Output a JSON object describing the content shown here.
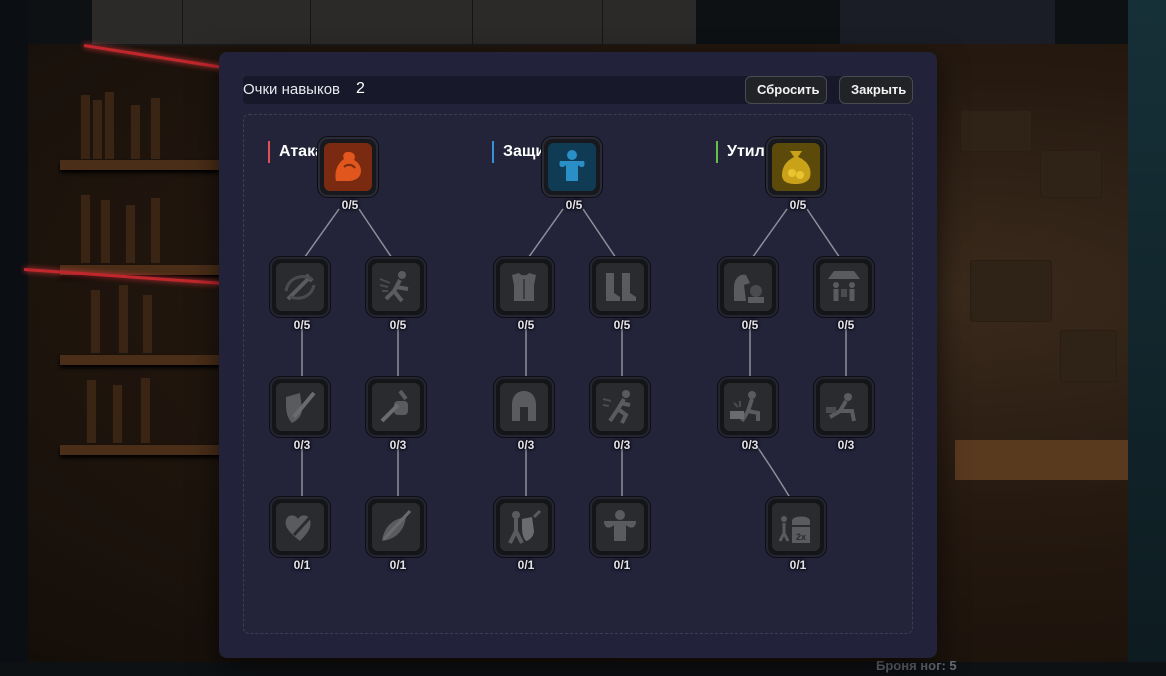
{
  "game": {
    "background_text": "Броня ног: 5"
  },
  "modal": {
    "header": {
      "points_label": "Очки навыков",
      "points_value": "2"
    },
    "buttons": {
      "reset": "Сбросить",
      "close": "Закрыть"
    },
    "branches": [
      {
        "title": "Атака",
        "accent": "#e05252",
        "root": {
          "icon": "flexed-biceps-icon",
          "level": "0/5",
          "color": "#d4541c"
        },
        "columns": [
          [
            {
              "icon": "sword-spin-icon",
              "level": "0/5"
            },
            {
              "icon": "sword-shield-icon",
              "level": "0/3"
            },
            {
              "icon": "heart-sword-icon",
              "level": "0/1"
            }
          ],
          [
            {
              "icon": "dodge-strike-icon",
              "level": "0/5"
            },
            {
              "icon": "fist-dagger-icon",
              "level": "0/3"
            },
            {
              "icon": "piercing-leaf-icon",
              "level": "0/1"
            }
          ]
        ]
      },
      {
        "title": "Защита",
        "accent": "#3b8fd9",
        "root": {
          "icon": "strong-man-icon",
          "level": "0/5",
          "color": "#2b8fc7"
        },
        "columns": [
          [
            {
              "icon": "chest-armor-icon",
              "level": "0/5"
            },
            {
              "icon": "helmet-icon",
              "level": "0/3"
            },
            {
              "icon": "deflect-warrior-icon",
              "level": "0/1"
            }
          ],
          [
            {
              "icon": "boots-icon",
              "level": "0/5"
            },
            {
              "icon": "running-dodge-icon",
              "level": "0/3"
            },
            {
              "icon": "muscle-body-icon",
              "level": "0/1"
            }
          ]
        ]
      },
      {
        "title": "Утилиты",
        "accent": "#62c24a",
        "root": {
          "icon": "gold-sack-icon",
          "level": "0/5",
          "color": "#c9a21a"
        },
        "columns": [
          [
            {
              "icon": "hand-coin-icon",
              "level": "0/5"
            },
            {
              "icon": "crafting-anvil-icon",
              "level": "0/3"
            },
            {
              "icon": "treasure-chest-2x-icon",
              "level": "0/1"
            }
          ],
          [
            {
              "icon": "market-stall-icon",
              "level": "0/5"
            },
            {
              "icon": "loot-kneel-icon",
              "level": "0/3"
            }
          ]
        ]
      }
    ]
  }
}
